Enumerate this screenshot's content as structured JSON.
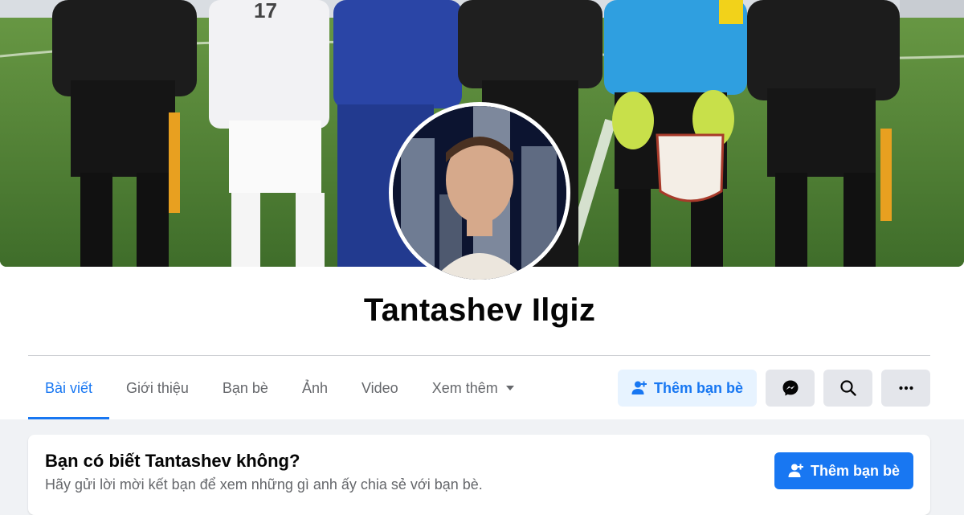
{
  "profile": {
    "name": "Tantashev Ilgiz"
  },
  "tabs": [
    {
      "label": "Bài viết",
      "active": true
    },
    {
      "label": "Giới thiệu",
      "active": false
    },
    {
      "label": "Bạn bè",
      "active": false
    },
    {
      "label": "Ảnh",
      "active": false
    },
    {
      "label": "Video",
      "active": false
    },
    {
      "label": "Xem thêm",
      "active": false
    }
  ],
  "actions": {
    "add_friend_label": "Thêm bạn bè",
    "messenger_icon": "messenger-icon",
    "search_icon": "search-icon",
    "more_icon": "more-icon"
  },
  "suggestion_card": {
    "title": "Bạn có biết Tantashev không?",
    "subtitle": "Hãy gửi lời mời kết bạn để xem những gì anh ấy chia sẻ với bạn bè.",
    "button_label": "Thêm bạn bè"
  },
  "colors": {
    "accent": "#1877f2",
    "accent_light": "#e7f3ff",
    "page_bg": "#f0f2f5",
    "button_gray": "#e4e6eb"
  }
}
